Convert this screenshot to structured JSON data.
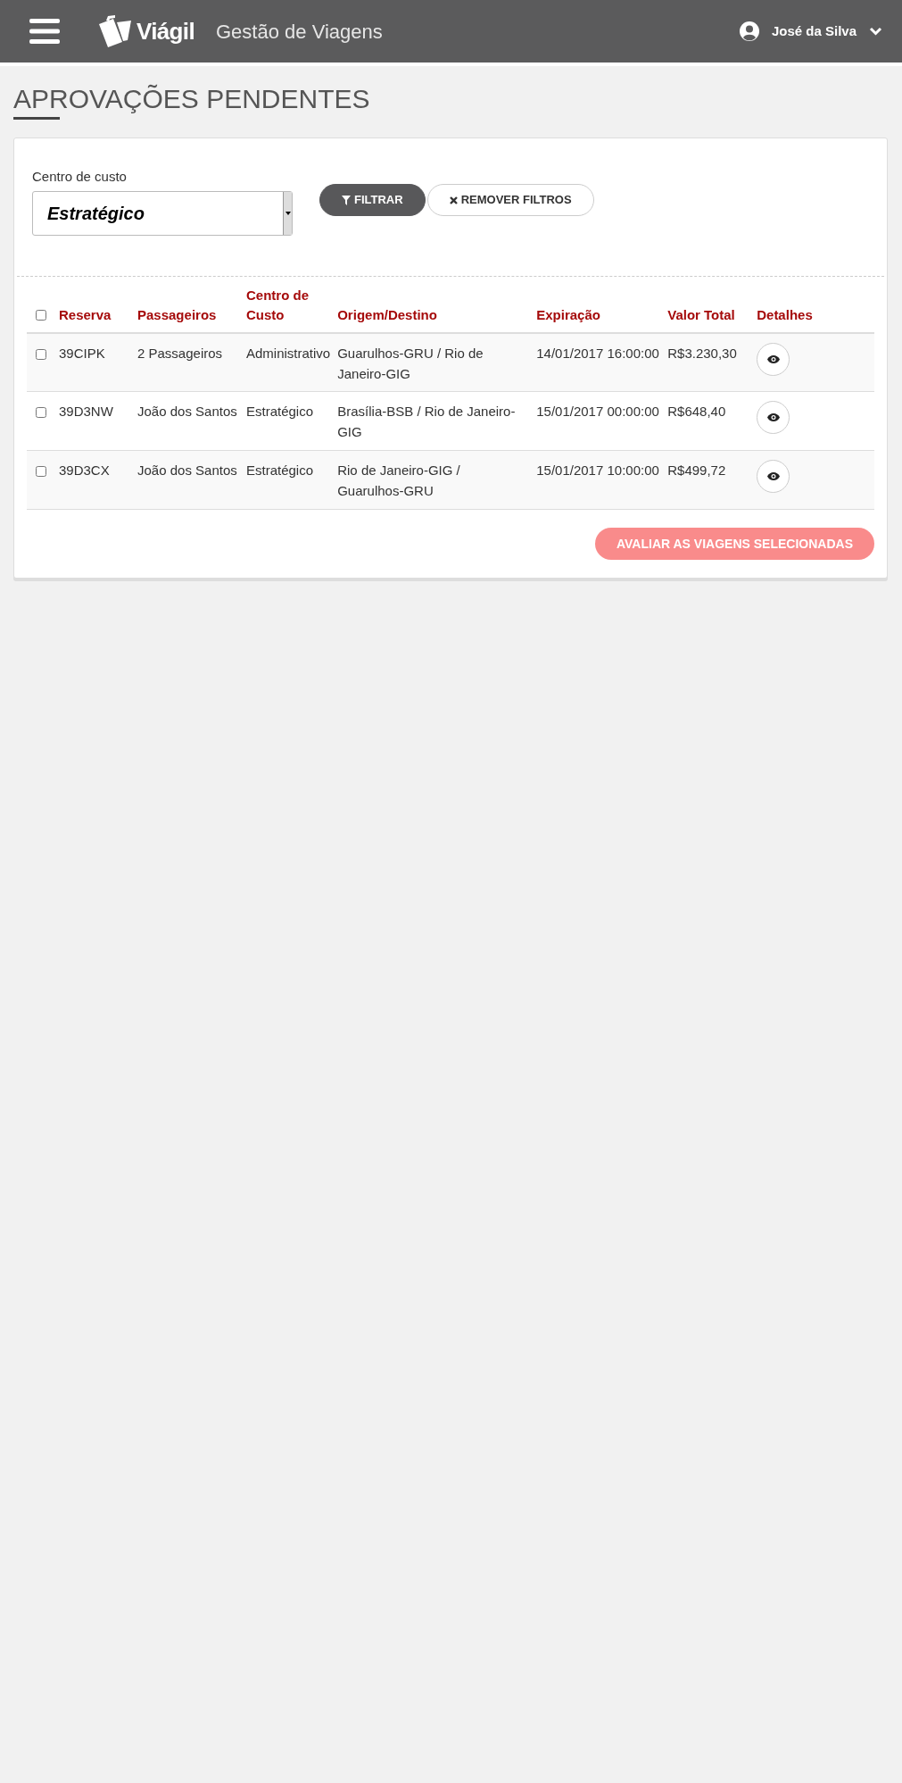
{
  "header": {
    "brand": "Viágil",
    "subtitle": "Gestão de Viagens",
    "user": "José da Silva"
  },
  "page_title": "APROVAÇÕES PENDENTES",
  "filter": {
    "label": "Centro de custo",
    "value": "Estratégico",
    "buttons": [
      {
        "kind": "primary",
        "label": "FILTRAR"
      },
      {
        "kind": "secondary",
        "label": "REMOVER FILTROS"
      }
    ]
  },
  "table": {
    "select_all_checked": false,
    "columns": [
      "Reserva",
      "Passageiros",
      "Centro de Custo",
      "Origem/Destino",
      "Expiração",
      "Valor Total",
      "Detalhes"
    ],
    "rows": [
      {
        "checked": false,
        "cells": [
          "39CIPK",
          "2 Passageiros",
          "Administrativo",
          "Guarulhos-GRU / Rio de Janeiro-GIG",
          "14/01/2017 16:00:00",
          "R$3.230,30"
        ]
      },
      {
        "checked": false,
        "cells": [
          "39D3NW",
          "João dos Santos",
          "Estratégico",
          "Brasília-BSB / Rio de Janeiro-GIG",
          "15/01/2017 00:00:00",
          "R$648,40"
        ]
      },
      {
        "checked": false,
        "cells": [
          "39D3CX",
          "João dos Santos",
          "Estratégico",
          "Rio de Janeiro-GIG / Guarulhos-GRU",
          "15/01/2017 10:00:00",
          "R$499,72"
        ]
      }
    ]
  },
  "action": {
    "label": "AVALIAR AS VIAGENS SELECIONADAS",
    "disabled": true
  }
}
